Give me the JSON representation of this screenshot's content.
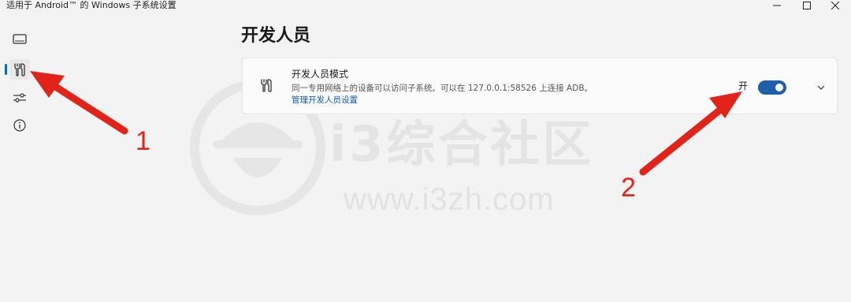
{
  "window": {
    "title": "适用于 Android™ 的 Windows 子系统设置",
    "controls": [
      "minimize-icon",
      "maximize-icon",
      "close-icon"
    ]
  },
  "sidebar": {
    "items": [
      {
        "icon": "monitor-icon",
        "selected": false
      },
      {
        "icon": "developer-tools-icon",
        "selected": true
      },
      {
        "icon": "sliders-icon",
        "selected": false
      },
      {
        "icon": "info-icon",
        "selected": false
      }
    ]
  },
  "main": {
    "title": "开发人员",
    "card": {
      "icon": "developer-tools-icon",
      "title": "开发人员模式",
      "description": "同一专用网络上的设备可以访问子系统。可以在 127.0.0.1:58526 上连接 ADB。",
      "link": "管理开发人员设置",
      "toggle_label": "开",
      "toggle_on": true
    }
  },
  "watermark": {
    "cn": "i3综合社区",
    "url": "www.i3zh.com"
  },
  "annotations": {
    "one": "1",
    "two": "2",
    "color": "#e2231a"
  },
  "colors": {
    "accent": "#1f5ea8",
    "background": "#f3f3f3",
    "card": "#fbfbfb",
    "link": "#0f5cb8"
  }
}
